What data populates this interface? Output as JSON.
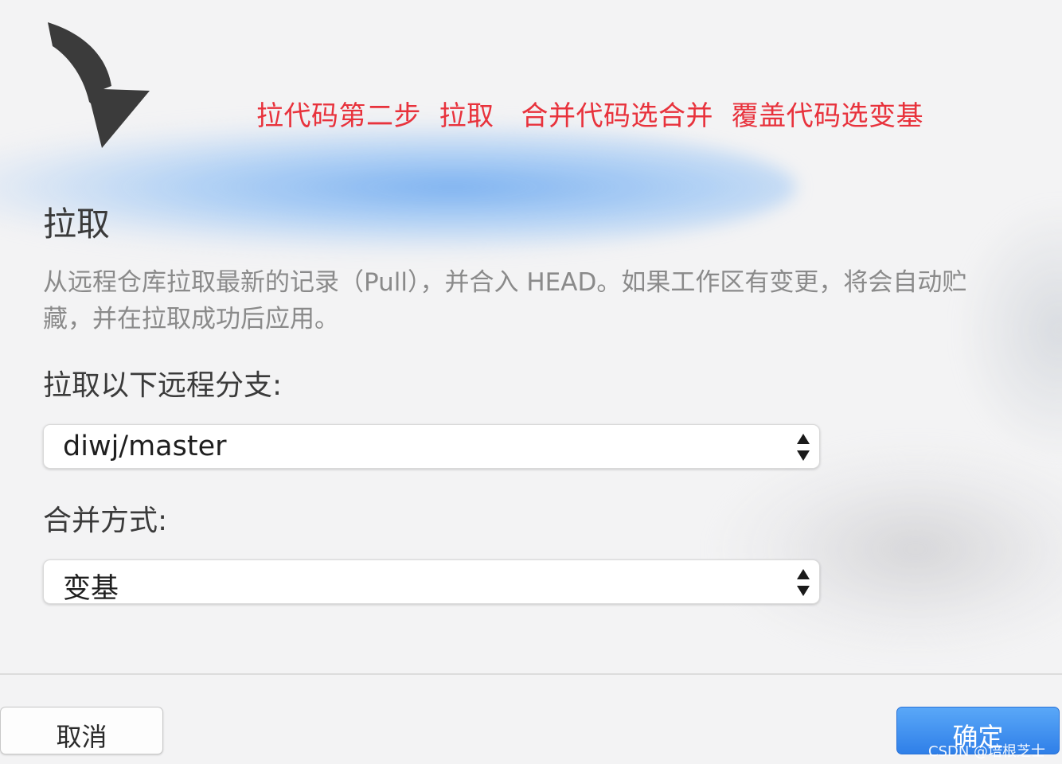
{
  "annotation": {
    "text": "拉代码第二步  拉取   合并代码选合并  覆盖代码选变基",
    "color": "#e8323c"
  },
  "dialog": {
    "icon": "down-arrow-icon",
    "title": "拉取",
    "description": "从远程仓库拉取最新的记录（Pull），并合入 HEAD。如果工作区有变更，将会自动贮藏，并在拉取成功后应用。",
    "branch_label": "拉取以下远程分支:",
    "branch_value": "diwj/master",
    "merge_label": "合并方式:",
    "merge_value": "变基",
    "cancel_label": "取消",
    "ok_label": "确定",
    "accent_color": "#2f7fe8"
  },
  "watermark": "CSDN @培根芝士"
}
